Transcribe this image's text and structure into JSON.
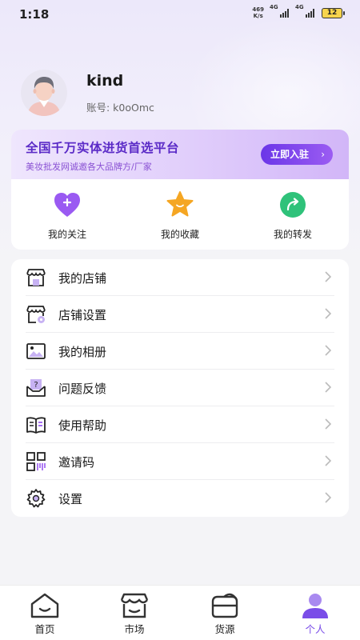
{
  "status_bar": {
    "time": "1:18",
    "net_speed_value": "469",
    "net_speed_unit": "K/s",
    "signal1": "4G",
    "signal2": "4G",
    "battery": "12"
  },
  "profile": {
    "username": "kind",
    "account": "账号: k0oOmc"
  },
  "banner": {
    "title": "全国千万实体进货首选平台",
    "subtitle": "美妆批发网诚邀各大品牌方/厂家",
    "button_label": "立即入驻",
    "button_chevron": "›"
  },
  "quick_actions": [
    {
      "label": "我的关注",
      "icon": "heart-plus-icon"
    },
    {
      "label": "我的收藏",
      "icon": "star-icon"
    },
    {
      "label": "我的转发",
      "icon": "share-icon"
    }
  ],
  "menu": [
    {
      "label": "我的店铺",
      "icon": "store-icon"
    },
    {
      "label": "店铺设置",
      "icon": "store-settings-icon"
    },
    {
      "label": "我的相册",
      "icon": "album-icon"
    },
    {
      "label": "问题反馈",
      "icon": "feedback-icon"
    },
    {
      "label": "使用帮助",
      "icon": "help-book-icon"
    },
    {
      "label": "邀请码",
      "icon": "qr-code-icon"
    },
    {
      "label": "设置",
      "icon": "gear-icon"
    }
  ],
  "bottom_nav": [
    {
      "label": "首页",
      "icon": "home-icon",
      "active": false
    },
    {
      "label": "市场",
      "icon": "market-icon",
      "active": false
    },
    {
      "label": "货源",
      "icon": "supply-icon",
      "active": false
    },
    {
      "label": "个人",
      "icon": "person-icon",
      "active": true
    }
  ],
  "colors": {
    "accent": "#7a4de8",
    "banner_title": "#5b2bc7",
    "heart": "#9a5af2",
    "star": "#f5a623",
    "share": "#2fc27a"
  }
}
